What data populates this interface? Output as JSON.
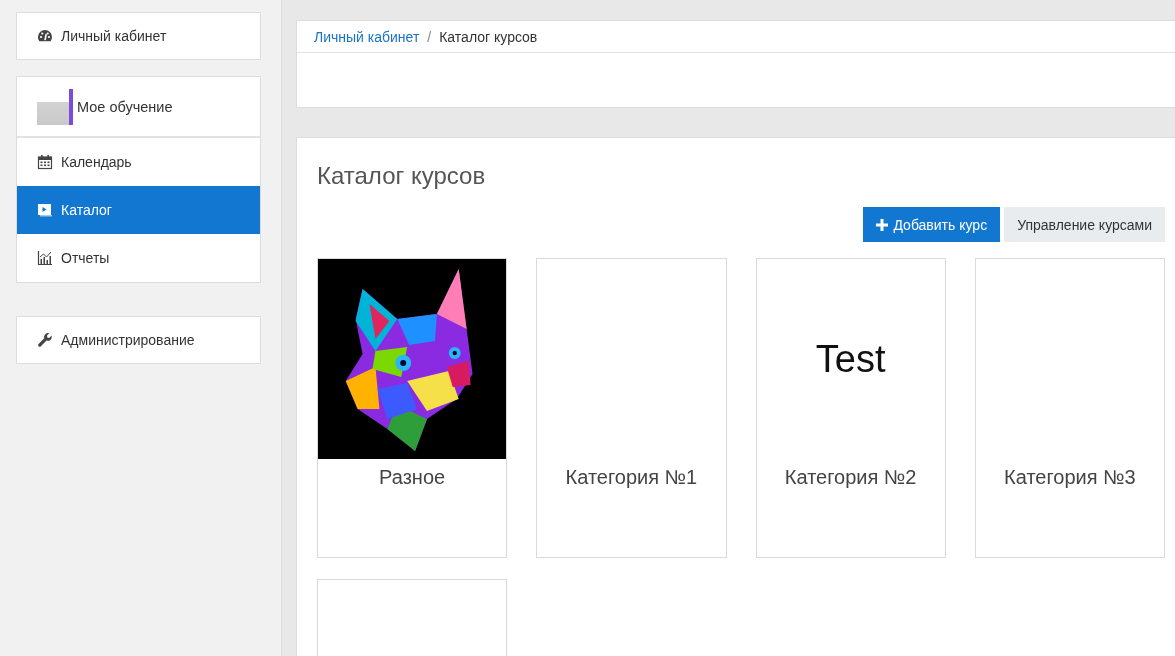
{
  "sidebar": {
    "groups": [
      {
        "items": [
          {
            "label": "Личный кабинет",
            "selected": false
          }
        ]
      },
      {
        "header": {
          "label": "Мое обучение"
        },
        "items": [
          {
            "label": "Календарь",
            "selected": false
          },
          {
            "label": "Каталог",
            "selected": true
          },
          {
            "label": "Отчеты",
            "selected": false
          }
        ]
      },
      {
        "items": [
          {
            "label": "Администрирование",
            "selected": false
          }
        ]
      }
    ]
  },
  "breadcrumb": [
    {
      "label": "Личный кабинет",
      "kind": "link"
    },
    {
      "label": "Каталог курсов",
      "kind": "current",
      "separator": "/"
    }
  ],
  "page": {
    "title": "Каталог курсов",
    "buttons": [
      {
        "label": "Добавить курс",
        "kind": "primary"
      },
      {
        "label": "Управление курсами",
        "kind": "secondary"
      }
    ],
    "categories": [
      {
        "kind": "card",
        "title": "Разное",
        "image": {
          "kind": "photo"
        }
      },
      {
        "kind": "card",
        "title": "Категория №1"
      },
      {
        "kind": "card",
        "title": "Категория №2",
        "image": {
          "kind": "text",
          "text": "Test"
        }
      },
      {
        "kind": "card",
        "title": "Категория №3"
      },
      {
        "kind": "cut_off"
      }
    ]
  }
}
